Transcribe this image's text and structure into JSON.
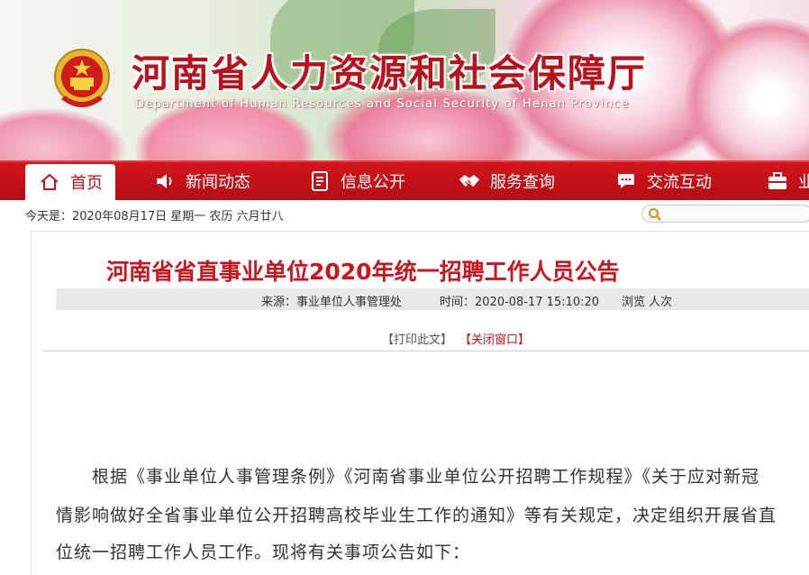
{
  "header": {
    "site_title": "河南省人力资源和社会保障厅",
    "site_subtitle": "Department of Human Resources and Social Security of Henan Province",
    "emblem_icon": "national-emblem-icon"
  },
  "nav": {
    "items": [
      {
        "label": "首页",
        "icon": "home-icon",
        "active": true
      },
      {
        "label": "新闻动态",
        "icon": "speaker-icon"
      },
      {
        "label": "信息公开",
        "icon": "document-icon"
      },
      {
        "label": "服务查询",
        "icon": "handshake-icon"
      },
      {
        "label": "交流互动",
        "icon": "chat-icon"
      },
      {
        "label": "业",
        "icon": "briefcase-icon"
      }
    ],
    "active_color": "#c4121a",
    "bar_color": "#c4121a"
  },
  "datebar": {
    "text": "今天是：2020年08月17日  星期一  农历 六月廿八"
  },
  "article": {
    "title": "河南省省直事业单位2020年统一招聘工作人员公告",
    "source": "来源：事业单位人事管理处",
    "time": "时间：2020-08-17 15:10:20",
    "views": "浏览 人次",
    "print_label": "【打印此文】",
    "close_label": "【关闭窗口】",
    "paragraph_lines": [
      "根据《事业单位人事管理条例》《河南省事业单位公开招聘工作规程》《关于应对新冠",
      "情影响做好全省事业单位公开招聘高校毕业生工作的通知》等有关规定，决定组织开展省直",
      "位统一招聘工作人员工作。现将有关事项公告如下："
    ]
  }
}
